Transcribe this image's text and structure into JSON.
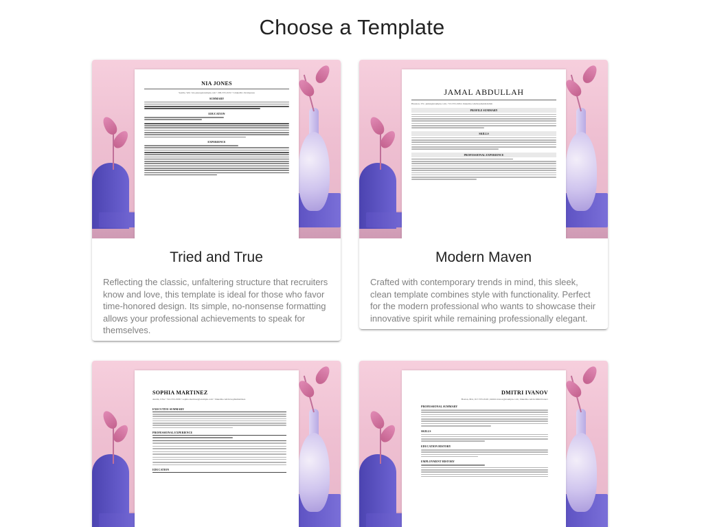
{
  "page": {
    "title": "Choose a Template"
  },
  "templates": [
    {
      "name": "Tried and True",
      "description": "Reflecting the classic, unfaltering structure that recruiters know and love, this template is ideal for those who favor time-honored design. Its simple, no-nonsense formatting allows your professional achievements to speak for themselves.",
      "preview": {
        "resume_name": "NIA JONES",
        "contact": "Seattle, WA • nia.jones@example.com • 206-555-0132 • LinkedIn: /in/niajones",
        "sections": [
          "SUMMARY",
          "EDUCATION",
          "EXPERIENCE"
        ]
      }
    },
    {
      "name": "Modern Maven",
      "description": "Crafted with contemporary trends in mind, this sleek, clean template combines style with functionality. Perfect for the modern professional who wants to showcase their innovative spirit while remaining professionally elegant.",
      "preview": {
        "resume_name": "JAMAL ABDULLAH",
        "contact": "Houston, TX | jamal@example.com | 713-555-0184 | linkedin.com/in/jamalabdullah",
        "sections": [
          "PROFILE SUMMARY",
          "SKILLS",
          "PROFESSIONAL EXPERIENCE"
        ]
      }
    },
    {
      "name": "",
      "description": "",
      "preview": {
        "resume_name": "SOPHIA MARTINEZ",
        "contact": "Austin, USA • 512-555-0199 • sophia.martinez@example.com • linkedin.com/in/sophiamartinez",
        "sections": [
          "EXECUTIVE SUMMARY",
          "PROFESSIONAL EXPERIENCE",
          "EDUCATION"
        ]
      }
    },
    {
      "name": "",
      "description": "",
      "preview": {
        "resume_name": "DMITRI IVANOV",
        "contact": "Boston, MA | 617-555-0149 | dmitri.ivanov@example.com | linkedin.com/in/dmitriivanov",
        "sections": [
          "PROFESSIONAL SUMMARY",
          "SKILLS",
          "EDUCATION HISTORY",
          "EMPLOYMENT HISTORY"
        ]
      }
    }
  ],
  "colors": {
    "background_pink": "#efc0d2",
    "accent_purple": "#5a4fc0",
    "title_text": "#222222",
    "description_text": "#808080"
  }
}
